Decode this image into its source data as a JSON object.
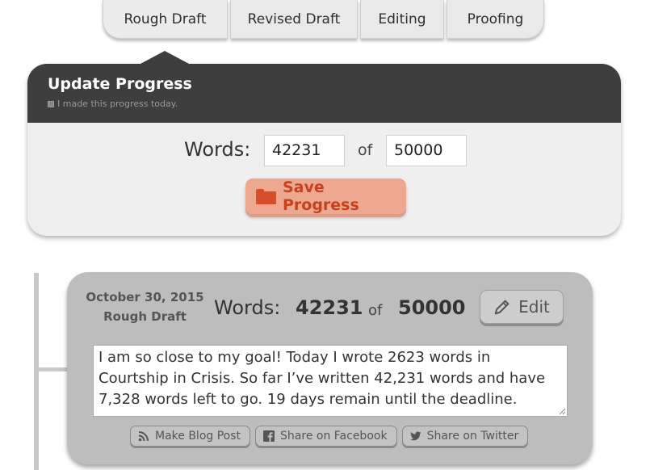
{
  "tabs": [
    {
      "label": "Rough Draft"
    },
    {
      "label": "Revised Draft"
    },
    {
      "label": "Editing"
    },
    {
      "label": "Proofing"
    }
  ],
  "update": {
    "title": "Update Progress",
    "checkbox_label": "I made this progress today.",
    "words_label": "Words:",
    "current_value": "42231",
    "of_label": "of",
    "goal_value": "50000",
    "save_label": "Save Progress"
  },
  "entry": {
    "date": "October 30, 2015",
    "stage": "Rough Draft",
    "words_label": "Words:",
    "current": "42231",
    "of_label": "of",
    "goal": "50000",
    "edit_label": "Edit",
    "text": "I am so close to my goal! Today I wrote 2623 words in Courtship in Crisis. So far I’ve written 42,231 words and have 7,328 words left to go. 19 days remain until the deadline.",
    "actions": [
      {
        "label": "Make Blog Post",
        "icon": "rss-icon"
      },
      {
        "label": "Share on Facebook",
        "icon": "facebook-icon"
      },
      {
        "label": "Share on Twitter",
        "icon": "twitter-icon"
      }
    ]
  },
  "colors": {
    "header_dark": "#3e3e3e",
    "save_button": "#efa890",
    "save_text": "#c8411e",
    "card": "#bdbdbd"
  }
}
